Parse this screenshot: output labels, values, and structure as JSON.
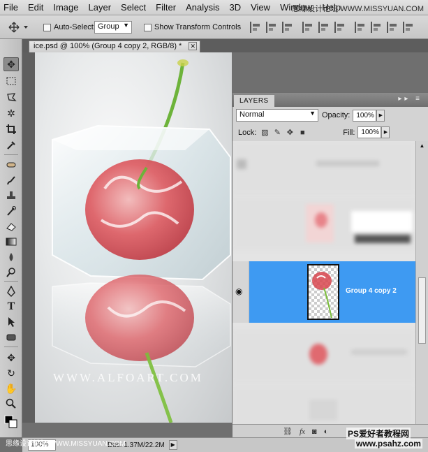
{
  "menu": [
    "File",
    "Edit",
    "Image",
    "Layer",
    "Select",
    "Filter",
    "Analysis",
    "3D",
    "View",
    "Window",
    "Help"
  ],
  "options_bar": {
    "auto_select_label": "Auto-Select:",
    "auto_select_value": "Group",
    "show_transform_label": "Show Transform Controls"
  },
  "document": {
    "tab_title": "ice.psd @ 100% (Group 4 copy 2, RGB/8) *",
    "canvas_credit": "WWW.ALFOART.COM"
  },
  "status": {
    "zoom": "100%",
    "doc_info": "Doc: 1.37M/22.2M"
  },
  "layers_panel": {
    "title": "LAYERS",
    "blend_mode": "Normal",
    "opacity_label": "Opacity:",
    "opacity_value": "100%",
    "lock_label": "Lock:",
    "fill_label": "Fill:",
    "fill_value": "100%",
    "selected_layer_name": "Group 4 copy 2"
  },
  "watermarks": {
    "top": "思缘设计论坛 WWW.MISSYUAN.COM",
    "bottom_left": "思缘设计论坛 WWW.MISSYUAN.COM",
    "bottom_right_1": "PS爱好者教程网",
    "bottom_right_2": "www.psahz.com"
  },
  "colors": {
    "selection_blue": "#3e9af2",
    "cherry_red": "#d8474f",
    "stem_green": "#7bbf3a"
  }
}
